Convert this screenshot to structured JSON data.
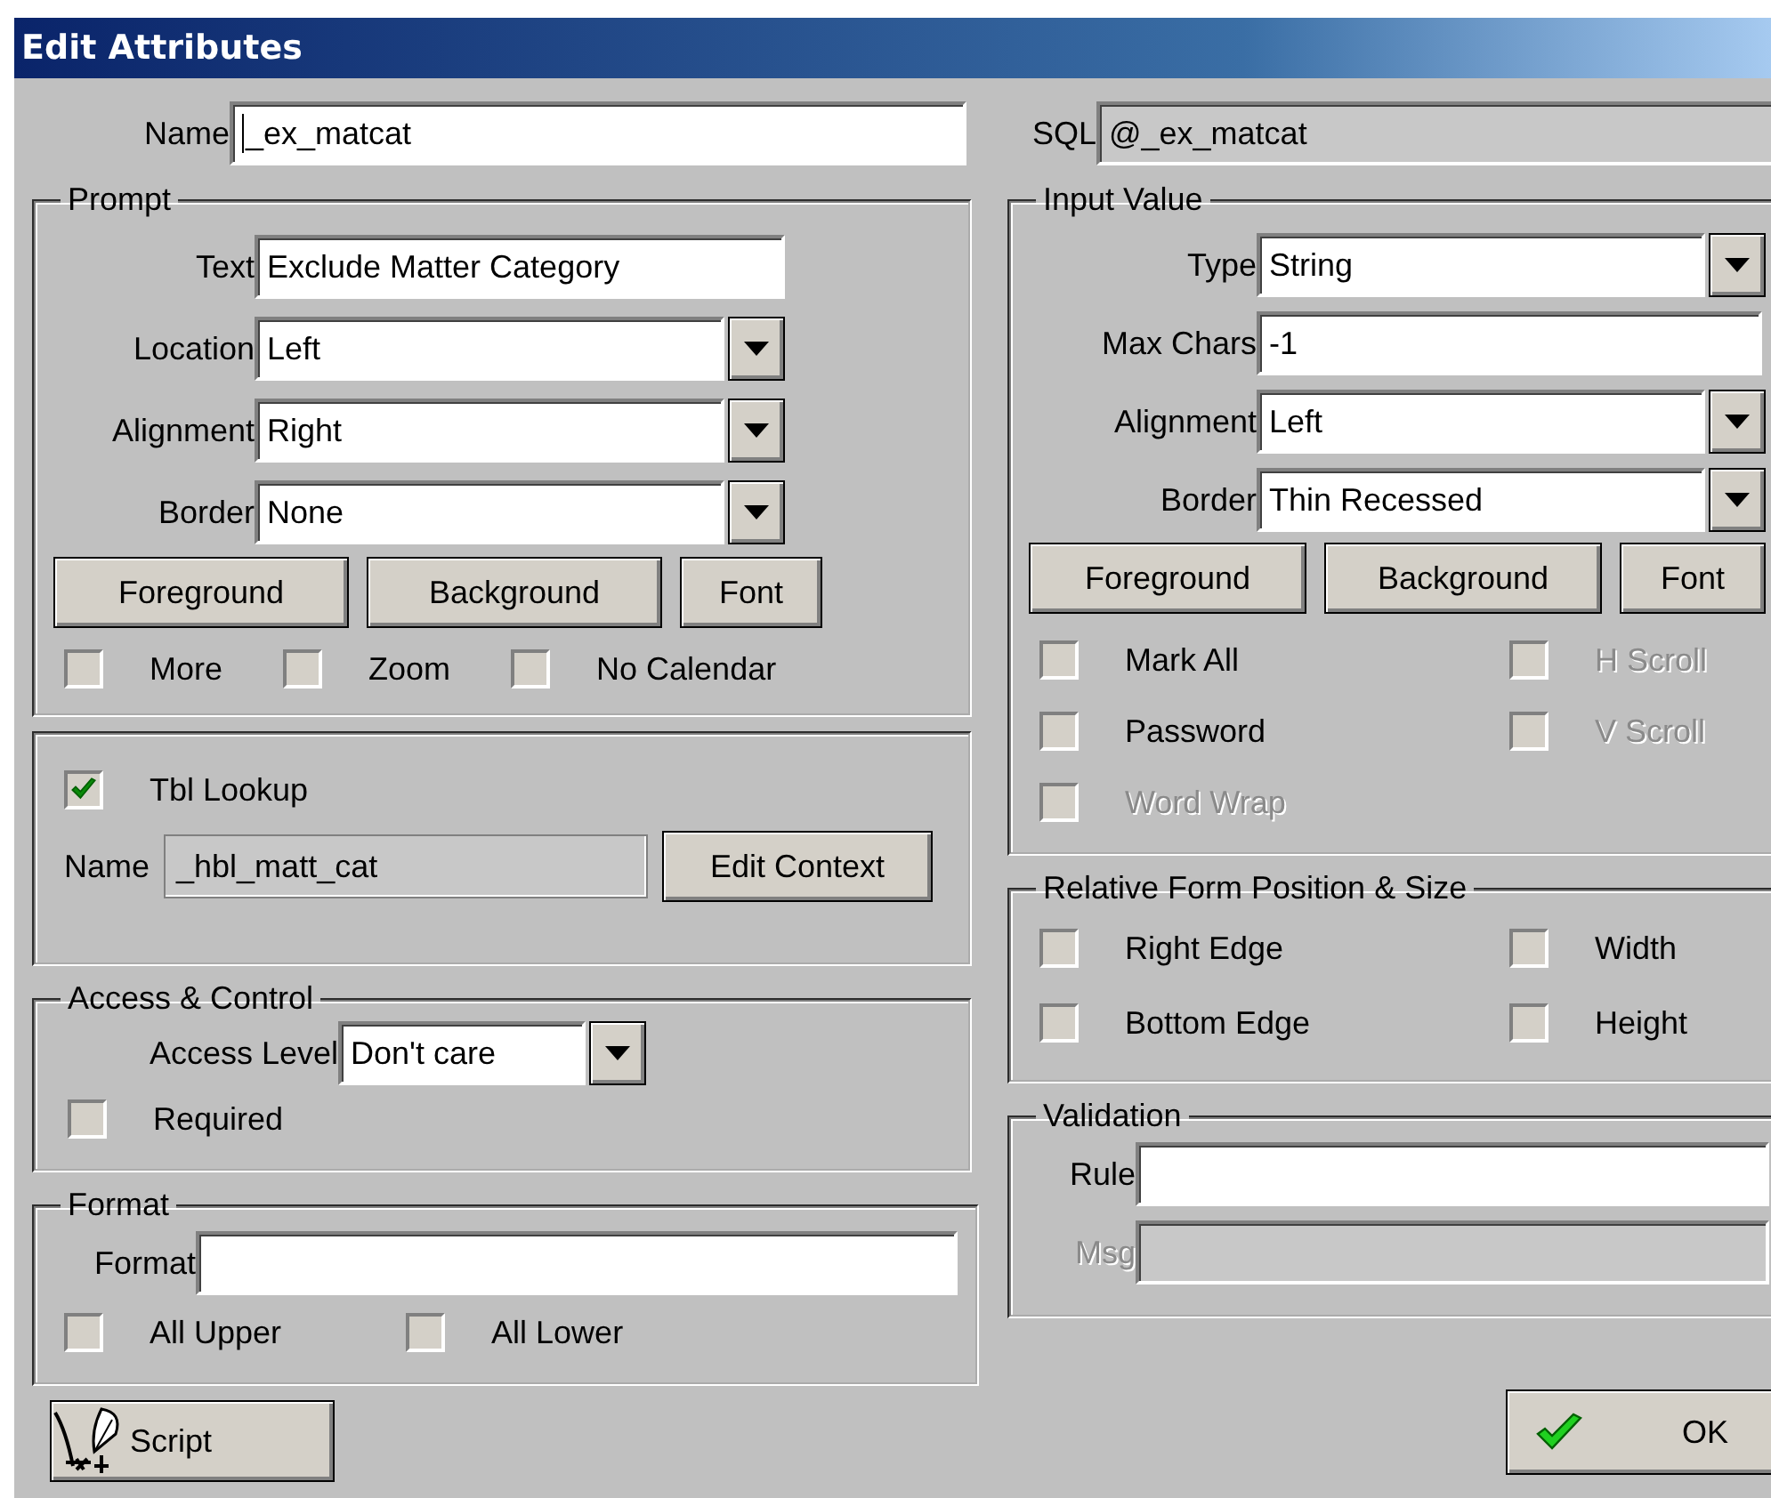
{
  "window": {
    "title": "Edit Attributes"
  },
  "name": {
    "label": "Name",
    "value": "_ex_matcat"
  },
  "sql": {
    "label": "SQL",
    "value": "@_ex_matcat",
    "read_only": true
  },
  "prompt": {
    "title": "Prompt",
    "fields": [
      {
        "label": "Text",
        "kind": "text",
        "value": "Exclude Matter Category"
      },
      {
        "label": "Location",
        "kind": "dropdown",
        "value": "Left"
      },
      {
        "label": "Alignment",
        "kind": "dropdown",
        "value": "Right"
      },
      {
        "label": "Border",
        "kind": "dropdown",
        "value": "None"
      }
    ],
    "buttons": [
      "Foreground",
      "Background",
      "Font"
    ],
    "checkboxes": [
      {
        "label": "More",
        "checked": false
      },
      {
        "label": "Zoom",
        "checked": false
      },
      {
        "label": "No Calendar",
        "checked": false
      }
    ]
  },
  "lookup": {
    "checkbox": {
      "label": "Tbl Lookup",
      "checked": true
    },
    "name": {
      "label": "Name",
      "value": "_hbl_matt_cat",
      "disabled": true
    },
    "button": "Edit Context"
  },
  "access": {
    "title": "Access & Control",
    "field": {
      "label": "Access Level",
      "kind": "dropdown",
      "value": "Don't care"
    },
    "checkbox": {
      "label": "Required",
      "checked": false
    }
  },
  "format": {
    "title": "Format",
    "field": {
      "label": "Format"
    },
    "checkboxes": [
      {
        "label": "All Upper",
        "checked": false
      },
      {
        "label": "All Lower",
        "checked": false
      }
    ]
  },
  "input_value": {
    "title": "Input Value",
    "fields": [
      {
        "label": "Type",
        "kind": "dropdown",
        "value": "String"
      },
      {
        "label": "Max Chars",
        "kind": "text",
        "value": "-1"
      },
      {
        "label": "Alignment",
        "kind": "dropdown",
        "value": "Left"
      },
      {
        "label": "Border",
        "kind": "dropdown",
        "value": "Thin Recessed"
      }
    ],
    "buttons": [
      "Foreground",
      "Background",
      "Font"
    ],
    "checkboxes": [
      {
        "label": "Mark All",
        "checked": false,
        "disabled": false
      },
      {
        "label": "H Scroll",
        "checked": false,
        "disabled": true
      },
      {
        "label": "Password",
        "checked": false,
        "disabled": false
      },
      {
        "label": "V Scroll",
        "checked": false,
        "disabled": true
      },
      {
        "label": "Word Wrap",
        "checked": false,
        "disabled": true
      }
    ]
  },
  "relative": {
    "title": "Relative Form Position & Size",
    "checkboxes": [
      {
        "label": "Right Edge",
        "checked": false
      },
      {
        "label": "Width",
        "checked": false
      },
      {
        "label": "Bottom Edge",
        "checked": false
      },
      {
        "label": "Height",
        "checked": false
      }
    ]
  },
  "validation": {
    "title": "Validation",
    "fields": [
      {
        "label": "Rule",
        "disabled": false
      },
      {
        "label": "Msg",
        "disabled": true
      }
    ]
  },
  "footer": {
    "script_button": "Script",
    "ok_button": "OK"
  }
}
